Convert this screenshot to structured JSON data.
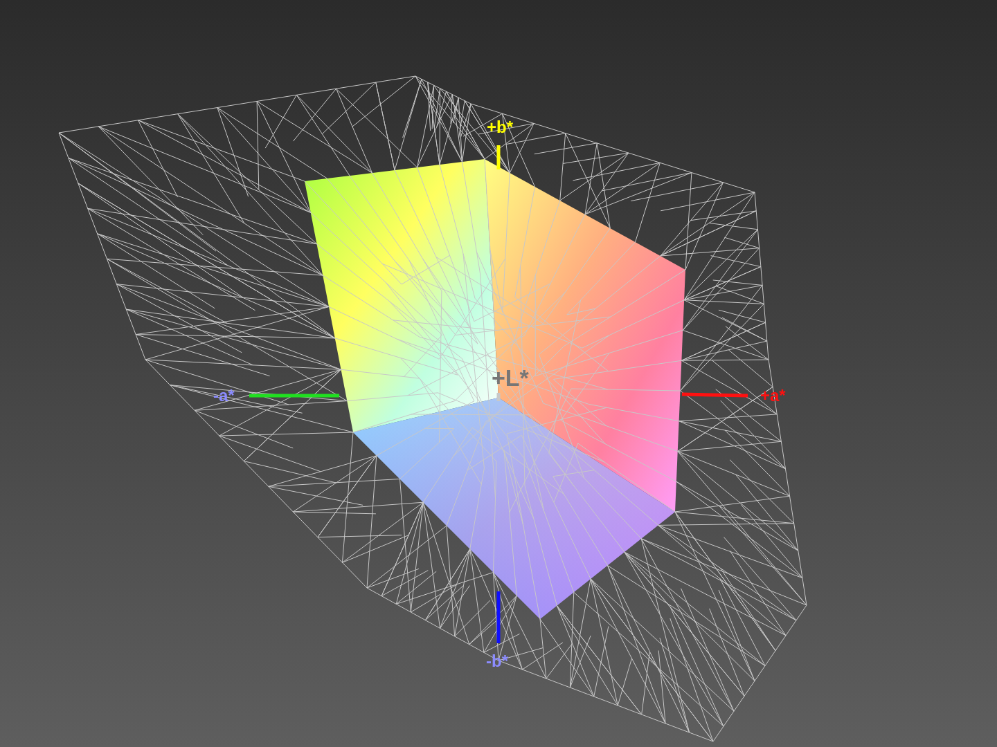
{
  "axes": [
    {
      "kind": "b-plus",
      "label": "+b*",
      "color": "#ffff00"
    },
    {
      "kind": "b-minus",
      "label": "-b*",
      "color": "#8c8cff"
    },
    {
      "kind": "a-plus",
      "label": "+a*",
      "color": "#ff1010"
    },
    {
      "kind": "a-minus",
      "label": "-a*",
      "color": "#8c8cff"
    },
    {
      "kind": "l-plus",
      "label": "+L*",
      "color": "#767676"
    }
  ]
}
